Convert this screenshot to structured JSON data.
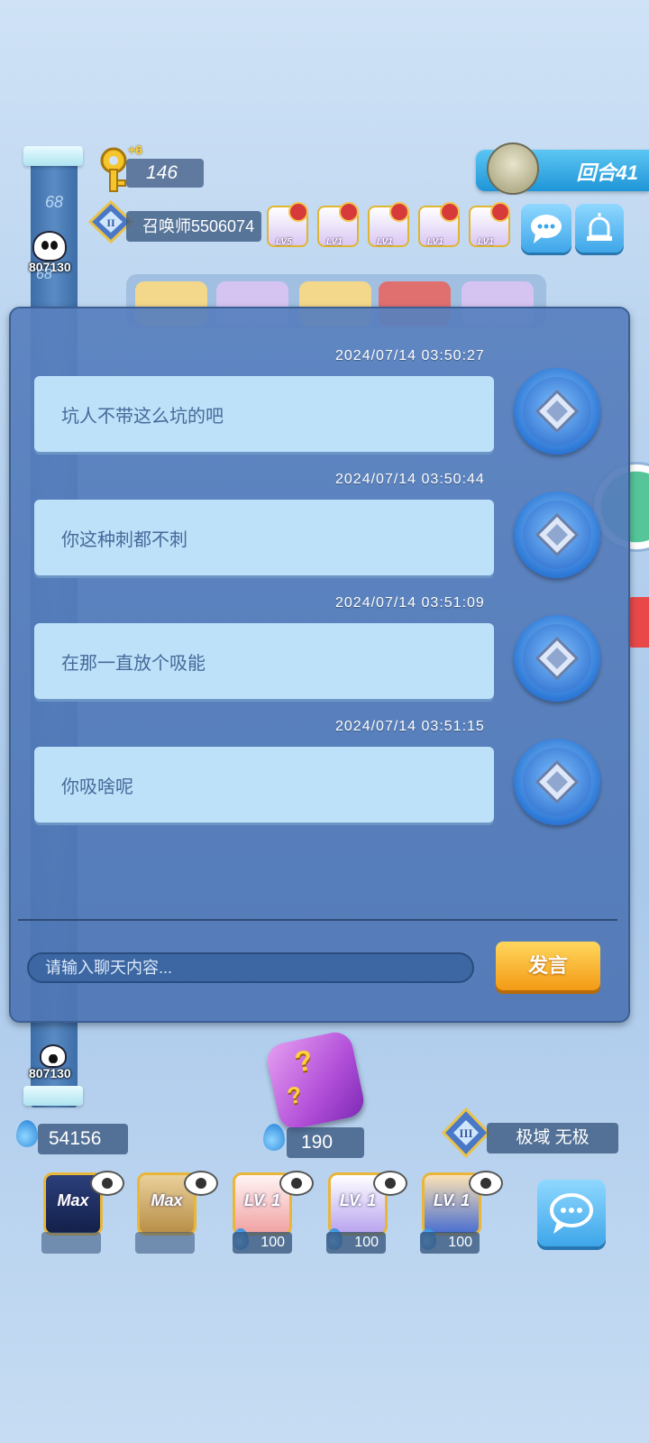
{
  "hud": {
    "hp_top_value": "68",
    "hp_top_value_2": "68",
    "enemy_hp": "807130",
    "self_hp": "807130",
    "key_count": "146",
    "key_bonus": "+6",
    "round": "回合41",
    "player_name": "召唤师5506074",
    "player_slots": [
      {
        "level": "LV5"
      },
      {
        "level": "LV1"
      },
      {
        "level": "LV1"
      },
      {
        "level": "LV1"
      },
      {
        "level": "LV1"
      }
    ]
  },
  "chat": {
    "messages": [
      {
        "time": "2024/07/14 03:50:27",
        "text": "坑人不带这么坑的吧"
      },
      {
        "time": "2024/07/14 03:50:44",
        "text": "你这种刺都不刺"
      },
      {
        "time": "2024/07/14 03:51:09",
        "text": "在那一直放个吸能"
      },
      {
        "time": "2024/07/14 03:51:15",
        "text": "你吸啥呢"
      }
    ],
    "input_placeholder": "请输入聊天内容...",
    "send_label": "发言"
  },
  "bottom": {
    "sp_left": "54156",
    "sp_center": "190",
    "rank_name": "极域 无极",
    "cards": [
      {
        "label": "Max",
        "cost": ""
      },
      {
        "label": "Max",
        "cost": ""
      },
      {
        "label": "LV. 1",
        "cost": "100"
      },
      {
        "label": "LV. 1",
        "cost": "100"
      },
      {
        "label": "LV. 1",
        "cost": "100"
      }
    ]
  }
}
